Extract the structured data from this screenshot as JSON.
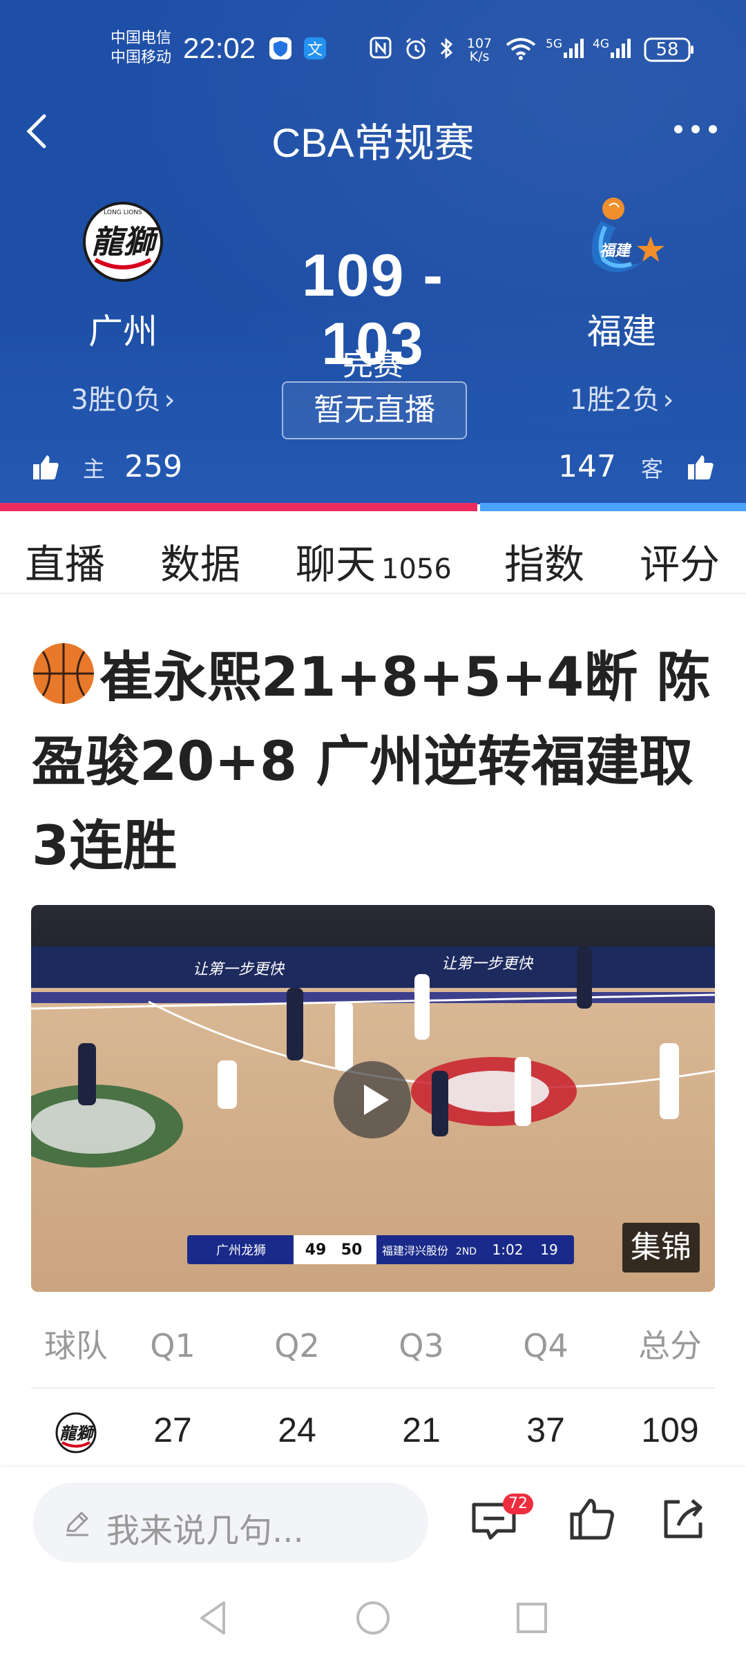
{
  "status_bar": {
    "carrier_1": "中国电信",
    "carrier_2": "中国移动",
    "time": "22:02",
    "net_speed_value": "107",
    "net_speed_unit": "K/s",
    "sig_5g": "5G",
    "sig_4g": "4G",
    "battery": "58"
  },
  "header": {
    "title": "CBA常规赛",
    "home": {
      "name": "广州",
      "record": "3胜0负",
      "likes": "259",
      "tag": "主"
    },
    "away": {
      "name": "福建",
      "record": "1胜2负",
      "likes": "147",
      "tag": "客"
    },
    "score": "109 - 103",
    "state": "完赛",
    "live_button": "暂无直播",
    "home_logo_text": "LONG LIONS",
    "colors": {
      "header_bg": "#1e4fa8",
      "home_bar": "#ee2d5f",
      "away_bar": "#4aa3ff"
    },
    "home_share": 0.64
  },
  "tabs": [
    {
      "label": "直播"
    },
    {
      "label": "数据"
    },
    {
      "label": "聊天",
      "count": "1056"
    },
    {
      "label": "指数"
    },
    {
      "label": "评分"
    }
  ],
  "article": {
    "headline": "崔永熙21+8+5+4断 陈盈骏20+8 广州逆转福建取3连胜",
    "video_tag": "集锦",
    "video_scoreboard": {
      "home_team": "广州龙狮",
      "home_score": "49",
      "away_score": "50",
      "away_team": "福建浔兴股份",
      "period": "2ND",
      "clock": "1:02",
      "shot_clock": "19"
    },
    "video_banner": "让第一步更快"
  },
  "score_table": {
    "headers": [
      "球队",
      "Q1",
      "Q2",
      "Q3",
      "Q4",
      "总分"
    ],
    "rows": [
      {
        "team_icon": "guangzhou-logo",
        "q": [
          "27",
          "24",
          "21",
          "37",
          "109"
        ]
      }
    ]
  },
  "bottom_bar": {
    "comment_placeholder": "我来说几句...",
    "comment_count": "72",
    "icons": [
      "comment-icon",
      "thumbs-up-icon",
      "share-icon"
    ]
  }
}
